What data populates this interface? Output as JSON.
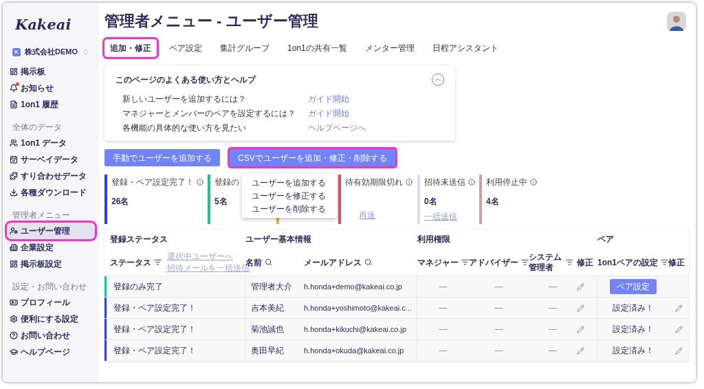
{
  "logo": "Kakeai",
  "company": {
    "badge": "K",
    "name": "株式会社DEMO"
  },
  "sidebar": {
    "sections": [
      {
        "items": [
          {
            "label": "掲示板",
            "kind": "board",
            "selected": false,
            "highlighted": false
          },
          {
            "label": "お知らせ",
            "kind": "bell",
            "selected": false,
            "highlighted": false,
            "badge": true
          },
          {
            "label": "1on1 履歴",
            "kind": "note",
            "selected": false,
            "highlighted": false
          }
        ]
      },
      {
        "heading": "全体のデータ",
        "items": [
          {
            "label": "1on1 データ",
            "kind": "people",
            "selected": false,
            "highlighted": false
          },
          {
            "label": "サーベイデータ",
            "kind": "calendar",
            "selected": false,
            "highlighted": false
          },
          {
            "label": "すり合わせデータ",
            "kind": "puzzle",
            "selected": false,
            "highlighted": false
          },
          {
            "label": "各種ダウンロード",
            "kind": "download",
            "selected": false,
            "highlighted": false
          }
        ]
      },
      {
        "heading": "管理者メニュー",
        "items": [
          {
            "label": "ユーザー管理",
            "kind": "usergear",
            "selected": true,
            "highlighted": true
          },
          {
            "label": "企業設定",
            "kind": "building",
            "selected": false,
            "highlighted": false
          },
          {
            "label": "掲示板設定",
            "kind": "board",
            "selected": false,
            "highlighted": false
          }
        ]
      },
      {
        "heading": "設定・お問い合わせ",
        "items": [
          {
            "label": "プロフィール",
            "kind": "id",
            "selected": false,
            "highlighted": false
          },
          {
            "label": "便利にする設定",
            "kind": "gear",
            "selected": false,
            "highlighted": false
          },
          {
            "label": "お問い合わせ",
            "kind": "help",
            "selected": false,
            "highlighted": false
          },
          {
            "label": "ヘルプページ",
            "kind": "cap",
            "selected": false,
            "highlighted": false
          }
        ]
      }
    ]
  },
  "title": "管理者メニュー - ユーザー管理",
  "tabs": [
    {
      "label": "追加・修正",
      "selected": true,
      "highlighted": true
    },
    {
      "label": "ペア設定",
      "selected": false,
      "highlighted": false
    },
    {
      "label": "集計グループ",
      "selected": false,
      "highlighted": false
    },
    {
      "label": "1on1の共有一覧",
      "selected": false,
      "highlighted": false
    },
    {
      "label": "メンター管理",
      "selected": false,
      "highlighted": false
    },
    {
      "label": "日程アシスタント",
      "selected": false,
      "highlighted": false
    }
  ],
  "help": {
    "title": "このページのよくある使い方とヘルプ",
    "expanded": true,
    "rows": [
      {
        "question": "新しいユーザーを追加するには？",
        "link": "ガイド開始"
      },
      {
        "question": "マネジャーとメンバーのペアを設定するには？",
        "link": "ガイド開始"
      },
      {
        "question": "各機能の具体的な使い方を見たい",
        "link": "ヘルプページへ"
      }
    ]
  },
  "actions": [
    {
      "label": "手動でユーザーを追加する",
      "highlighted": false
    },
    {
      "label": "CSVでユーザーを追加・修正・削除する",
      "highlighted": true
    }
  ],
  "csv_menu": [
    "ユーザーを追加する",
    "ユーザーを修正する",
    "ユーザーを削除する"
  ],
  "stats": [
    {
      "label": "登録・ペア設定完了！",
      "value": "26名",
      "color": "#2f3cf5",
      "info": true
    },
    {
      "label": "登録の",
      "value": "5名",
      "color": "#22c08a"
    },
    {
      "color": "#e6b33a"
    },
    {
      "label": "待有効期限切れ",
      "color": "#e0505a",
      "info": true,
      "link": "再送"
    },
    {
      "label": "招待未送信",
      "value": "0名",
      "color": "#d9ddf5",
      "info": true,
      "link": "一括送信"
    },
    {
      "label": "利用停止中",
      "value": "4名",
      "color": "#c9a3a3",
      "info": true
    }
  ],
  "table": {
    "groups": [
      "登録ステータス",
      "ユーザー基本情報",
      "利用権限",
      "ペア"
    ],
    "bulk_links": [
      "選択中ユーザーへ",
      "招待メールを一括送信"
    ],
    "columns": [
      {
        "label": "ステータス",
        "kind": "filter"
      },
      {
        "label": "名前",
        "kind": "search"
      },
      {
        "label": "メールアドレス",
        "kind": "search"
      },
      {
        "label": "マネジャー",
        "kind": "filter"
      },
      {
        "label": "アドバイザー",
        "kind": "filter"
      },
      {
        "label": "システム管理者",
        "kind": "filter"
      },
      {
        "label": "修正",
        "kind": "plain"
      },
      {
        "label": "1on1ペアの設定",
        "kind": "filter"
      },
      {
        "label": "修正",
        "kind": "plain"
      }
    ],
    "rows": [
      {
        "status": "登録のみ完了",
        "color": "#22c08a",
        "name": "管理者大介",
        "email": "h.honda+demo@kakeai.co.jp",
        "manager": "—",
        "advisor": "—",
        "admin": "—",
        "pair": {
          "kind": "button",
          "label": "ペア設定"
        }
      },
      {
        "status": "登録・ペア設定完了！",
        "color": "#2f3cf5",
        "name": "吉本美紀",
        "email": "h.honda+yoshimoto@kakeai.c...",
        "manager": "—",
        "advisor": "—",
        "admin": "—",
        "pair": {
          "kind": "text",
          "label": "設定済み！"
        }
      },
      {
        "status": "登録・ペア設定完了！",
        "color": "#2f3cf5",
        "name": "菊池誠也",
        "email": "h.honda+kikuchi@kakeai.co.jp",
        "manager": "—",
        "advisor": "—",
        "admin": "—",
        "pair": {
          "kind": "text",
          "label": "設定済み！"
        }
      },
      {
        "status": "登録・ペア設定完了！",
        "color": "#2f3cf5",
        "name": "奥田早紀",
        "email": "h.honda+okuda@kakeai.co.jp",
        "manager": "—",
        "advisor": "—",
        "admin": "—",
        "pair": {
          "kind": "text",
          "label": "設定済み！"
        }
      }
    ]
  }
}
